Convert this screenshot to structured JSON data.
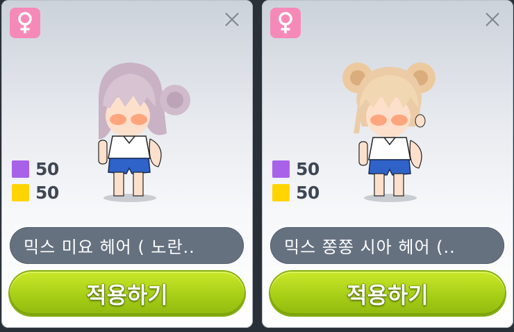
{
  "colors": {
    "gender_badge": "#f58ab8",
    "stat_purple": "#a862ea",
    "stat_yellow": "#ffd400",
    "name_pill": "#667180",
    "apply_button": "#a7cf17"
  },
  "icons": {
    "gender": "female-symbol",
    "close": "close-x"
  },
  "cards": [
    {
      "name": "믹스 미요 헤어 ( 노란..",
      "stats": [
        {
          "color": "purple",
          "value": "50"
        },
        {
          "color": "yellow",
          "value": "50"
        }
      ],
      "apply_label": "적용하기"
    },
    {
      "name": "믹스 쫑쫑 시아 헤어 (..",
      "stats": [
        {
          "color": "purple",
          "value": "50"
        },
        {
          "color": "yellow",
          "value": "50"
        }
      ],
      "apply_label": "적용하기"
    }
  ]
}
